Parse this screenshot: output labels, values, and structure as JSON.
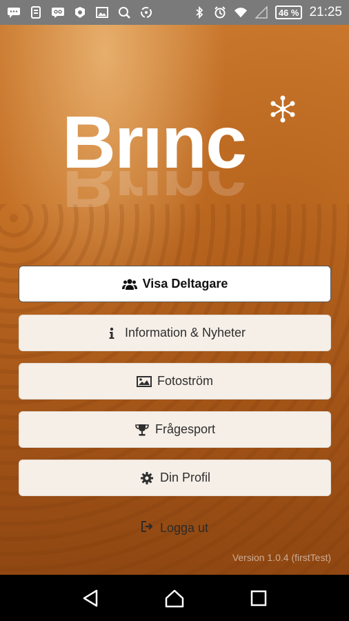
{
  "status_bar": {
    "battery": "46 %",
    "time": "21:25",
    "icons": [
      "chat-icon",
      "phone-icon",
      "voicemail-icon",
      "shield-icon",
      "image-icon",
      "search-icon",
      "sync-icon",
      "bluetooth-icon",
      "alarm-icon",
      "wifi-icon",
      "signal-icon"
    ]
  },
  "app": {
    "logo_text": "Brınc",
    "version": "Version 1.0.4 (firstTest)"
  },
  "menu": {
    "items": [
      {
        "label": "Visa Deltagare",
        "icon": "users-icon"
      },
      {
        "label": "Information & Nyheter",
        "icon": "info-icon"
      },
      {
        "label": "Fotoström",
        "icon": "image-icon"
      },
      {
        "label": "Frågesport",
        "icon": "trophy-icon"
      },
      {
        "label": "Din Profil",
        "icon": "gear-icon"
      }
    ],
    "logout_label": "Logga ut"
  },
  "colors": {
    "brand_orange": "#c46f25",
    "button_bg": "#f6efe8",
    "status_bar": "#7a7a7a"
  }
}
